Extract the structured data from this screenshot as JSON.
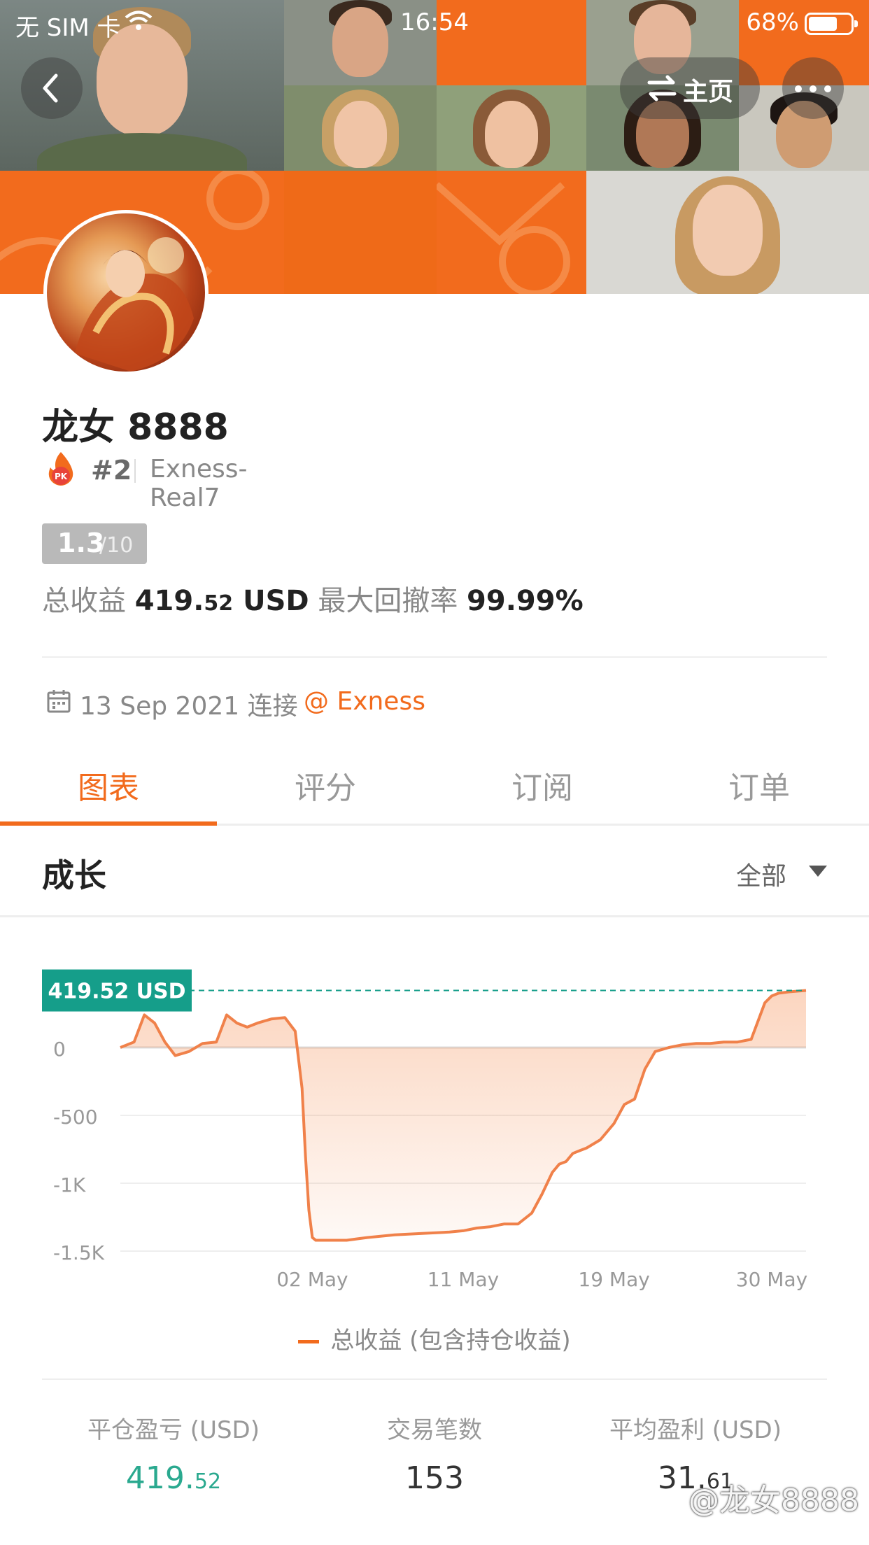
{
  "status_bar": {
    "carrier": "无 SIM 卡",
    "time": "16:54",
    "battery": "68%"
  },
  "nav": {
    "home_label": "主页"
  },
  "profile": {
    "name": "龙女 8888",
    "rank": "#2",
    "server": "Exness-Real7",
    "score": "1.3",
    "score_max": "/10",
    "total_profit_label": "总收益",
    "total_profit_int": "419.",
    "total_profit_dec": "52",
    "total_profit_unit": "USD",
    "max_drawdown_label": "最大回撤率",
    "max_drawdown": "99.99%",
    "connected_date": "13 Sep 2021 连接",
    "broker": "@ Exness"
  },
  "tabs": [
    {
      "label": "图表",
      "active": true
    },
    {
      "label": "评分",
      "active": false
    },
    {
      "label": "订阅",
      "active": false
    },
    {
      "label": "订单",
      "active": false
    }
  ],
  "section": {
    "title": "成长",
    "filter": "全部"
  },
  "colors": {
    "accent": "#f26b1d",
    "teal": "#159e8a",
    "green": "#2aa98f"
  },
  "chart_data": {
    "type": "area",
    "value_label": "419.52 USD",
    "y_ticks": [
      "0",
      "-500",
      "-1K",
      "-1.5K"
    ],
    "y_tick_values": [
      0,
      -500,
      -1000,
      -1500
    ],
    "x_ticks": [
      "02 May",
      "11 May",
      "19 May",
      "30 May"
    ],
    "x_tick_values": [
      0.28,
      0.5,
      0.72,
      0.95
    ],
    "ylim": [
      -1500,
      500
    ],
    "legend": "总收益 (包含持仓收益)",
    "series": [
      {
        "name": "总收益 (包含持仓收益)",
        "x": [
          0.0,
          0.02,
          0.035,
          0.05,
          0.065,
          0.08,
          0.1,
          0.12,
          0.14,
          0.155,
          0.17,
          0.185,
          0.2,
          0.22,
          0.24,
          0.255,
          0.265,
          0.27,
          0.275,
          0.28,
          0.285,
          0.29,
          0.31,
          0.33,
          0.36,
          0.4,
          0.44,
          0.48,
          0.5,
          0.52,
          0.54,
          0.56,
          0.58,
          0.6,
          0.615,
          0.63,
          0.64,
          0.65,
          0.66,
          0.67,
          0.68,
          0.7,
          0.72,
          0.735,
          0.75,
          0.765,
          0.78,
          0.8,
          0.82,
          0.84,
          0.86,
          0.88,
          0.9,
          0.92,
          0.94,
          0.95,
          0.96,
          0.975,
          1.0
        ],
        "y": [
          0,
          40,
          240,
          180,
          40,
          -60,
          -30,
          30,
          40,
          240,
          180,
          150,
          180,
          210,
          220,
          120,
          -300,
          -800,
          -1200,
          -1400,
          -1420,
          -1420,
          -1420,
          -1420,
          -1400,
          -1380,
          -1370,
          -1360,
          -1350,
          -1330,
          -1320,
          -1300,
          -1300,
          -1220,
          -1080,
          -920,
          -860,
          -840,
          -780,
          -760,
          -740,
          -680,
          -560,
          -420,
          -380,
          -160,
          -30,
          0,
          20,
          30,
          30,
          40,
          40,
          60,
          330,
          380,
          400,
          410,
          420
        ]
      }
    ]
  },
  "bottom_stats": [
    {
      "label": "平仓盈亏 (USD)",
      "value_int": "419.",
      "value_dec": "52"
    },
    {
      "label": "交易笔数",
      "value_int": "153",
      "value_dec": ""
    },
    {
      "label": "平均盈利 (USD)",
      "value_int": "31.",
      "value_dec": "61"
    }
  ],
  "watermark": "@龙女8888"
}
